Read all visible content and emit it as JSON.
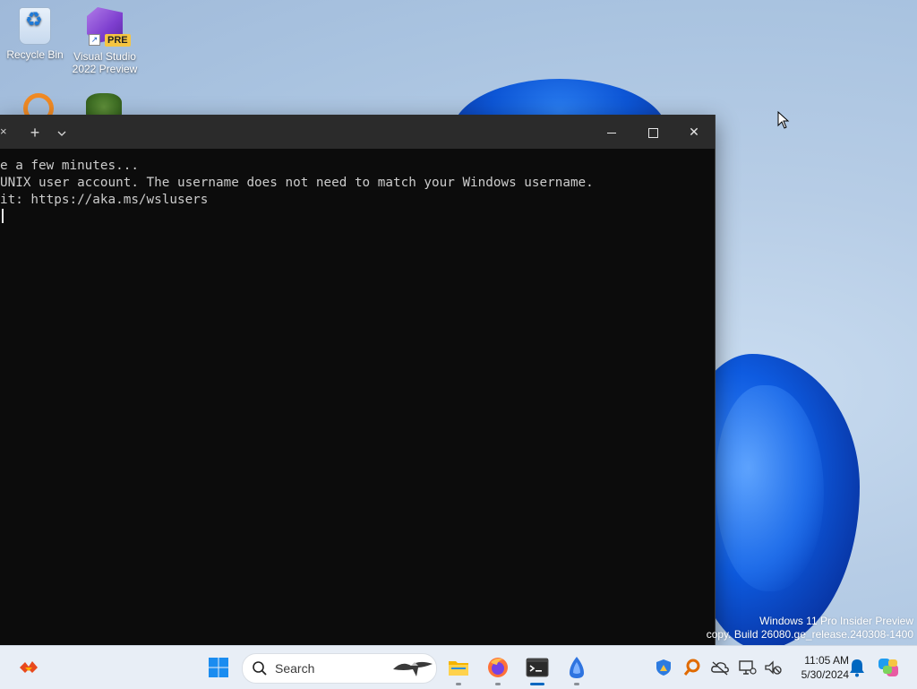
{
  "desktop": {
    "icons": [
      {
        "label_line1": "Recycle Bin",
        "label_line2": ""
      },
      {
        "label_line1": "Visual Studio",
        "label_line2": "2022 Preview",
        "badge": "PRE"
      }
    ]
  },
  "terminal": {
    "tab_overflow_glyph": "×",
    "new_tab_glyph": "+",
    "dropdown_glyph": "⌄",
    "close_glyph": "✕",
    "lines": [
      "e a few minutes...",
      "UNIX user account. The username does not need to match your Windows username.",
      "it: https://aka.ms/wslusers"
    ],
    "background_color": "#0c0c0c",
    "text_color": "#cccccc"
  },
  "watermark": {
    "line1": "Windows 11 Pro Insider Preview",
    "line2": "copy. Build 26080.ge_release.240308-1400"
  },
  "taskbar": {
    "search_label": "Search",
    "clock_time": "11:05 AM",
    "clock_date": "5/30/2024",
    "accent_color": "#0067c0",
    "pinned": [
      "widgets-icon",
      "start-icon",
      "file-explorer-icon",
      "firefox-icon",
      "terminal-icon",
      "app-icon"
    ],
    "tray": [
      "security-icon",
      "search-app-icon",
      "onedrive-icon",
      "network-icon",
      "volume-icon",
      "bell-icon",
      "copilot-icon"
    ]
  }
}
